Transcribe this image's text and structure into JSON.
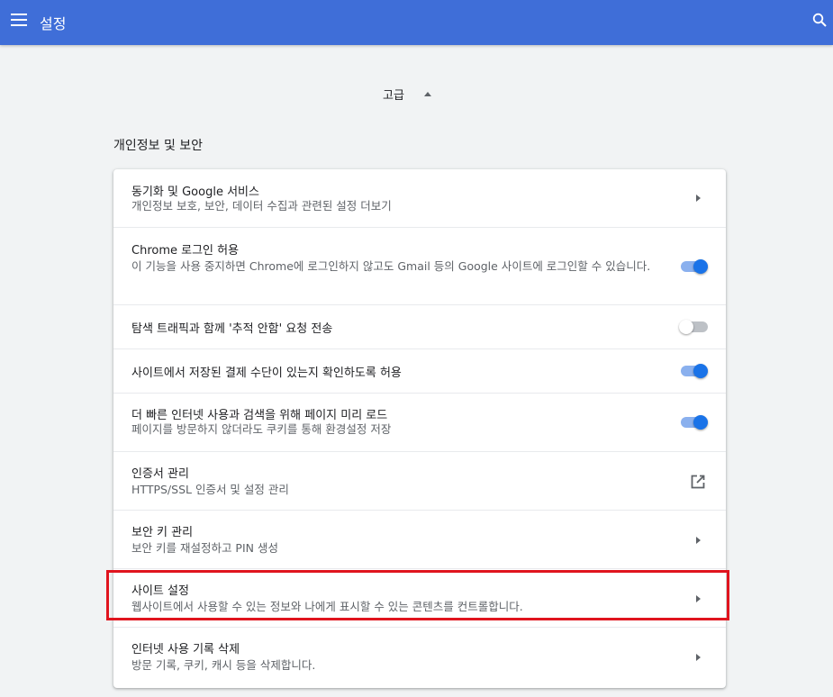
{
  "toolbar": {
    "title": "설정",
    "menu_icon": "menu-icon",
    "search_icon": "search-icon"
  },
  "advanced": {
    "label": "고급",
    "icon": "caret-up-icon"
  },
  "section": {
    "title": "개인정보 및 보안"
  },
  "rows": [
    {
      "title": "동기화 및 Google 서비스",
      "subtitle": "개인정보 보호, 보안, 데이터 수집과 관련된 설정 더보기",
      "control": "arrow"
    },
    {
      "title": "Chrome 로그인 허용",
      "subtitle": "이 기능을 사용 중지하면 Chrome에 로그인하지 않고도 Gmail 등의 Google 사이트에 로그인할 수 있습니다.",
      "control": "toggle",
      "toggle_on": true
    },
    {
      "title": "탐색 트래픽과 함께 '추적 안함' 요청 전송",
      "control": "toggle",
      "toggle_on": false
    },
    {
      "title": "사이트에서 저장된 결제 수단이 있는지 확인하도록 허용",
      "control": "toggle",
      "toggle_on": true
    },
    {
      "title": "더 빠른 인터넷 사용과 검색을 위해 페이지 미리 로드",
      "subtitle": "페이지를 방문하지 않더라도 쿠키를 통해 환경설정 저장",
      "control": "toggle",
      "toggle_on": true
    },
    {
      "title": "인증서 관리",
      "subtitle": "HTTPS/SSL 인증서 및 설정 관리",
      "control": "external-link"
    },
    {
      "title": "보안 키 관리",
      "subtitle": "보안 키를 재설정하고 PIN 생성",
      "control": "arrow"
    },
    {
      "title": "사이트 설정",
      "subtitle": "웹사이트에서 사용할 수 있는 정보와 나에게 표시할 수 있는 콘텐츠를 컨트롤합니다.",
      "control": "arrow",
      "highlighted": true
    },
    {
      "title": "인터넷 사용 기록 삭제",
      "subtitle": "방문 기록, 쿠키, 캐시 등을 삭제합니다.",
      "control": "arrow"
    }
  ],
  "colors": {
    "toolbar": "#3f6ed8",
    "accent": "#1a73e8",
    "highlight": "#e0141e",
    "background": "#f1f3f4"
  }
}
